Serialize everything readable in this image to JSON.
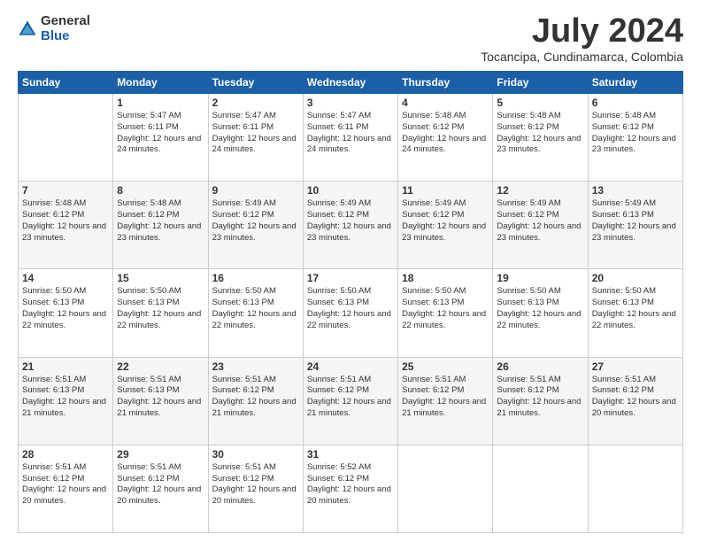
{
  "logo": {
    "general": "General",
    "blue": "Blue"
  },
  "title": "July 2024",
  "location": "Tocancipa, Cundinamarca, Colombia",
  "days_of_week": [
    "Sunday",
    "Monday",
    "Tuesday",
    "Wednesday",
    "Thursday",
    "Friday",
    "Saturday"
  ],
  "weeks": [
    [
      {
        "day": "",
        "sunrise": "",
        "sunset": "",
        "daylight": ""
      },
      {
        "day": "1",
        "sunrise": "Sunrise: 5:47 AM",
        "sunset": "Sunset: 6:11 PM",
        "daylight": "Daylight: 12 hours and 24 minutes."
      },
      {
        "day": "2",
        "sunrise": "Sunrise: 5:47 AM",
        "sunset": "Sunset: 6:11 PM",
        "daylight": "Daylight: 12 hours and 24 minutes."
      },
      {
        "day": "3",
        "sunrise": "Sunrise: 5:47 AM",
        "sunset": "Sunset: 6:11 PM",
        "daylight": "Daylight: 12 hours and 24 minutes."
      },
      {
        "day": "4",
        "sunrise": "Sunrise: 5:48 AM",
        "sunset": "Sunset: 6:12 PM",
        "daylight": "Daylight: 12 hours and 24 minutes."
      },
      {
        "day": "5",
        "sunrise": "Sunrise: 5:48 AM",
        "sunset": "Sunset: 6:12 PM",
        "daylight": "Daylight: 12 hours and 23 minutes."
      },
      {
        "day": "6",
        "sunrise": "Sunrise: 5:48 AM",
        "sunset": "Sunset: 6:12 PM",
        "daylight": "Daylight: 12 hours and 23 minutes."
      }
    ],
    [
      {
        "day": "7",
        "sunrise": "Sunrise: 5:48 AM",
        "sunset": "Sunset: 6:12 PM",
        "daylight": "Daylight: 12 hours and 23 minutes."
      },
      {
        "day": "8",
        "sunrise": "Sunrise: 5:48 AM",
        "sunset": "Sunset: 6:12 PM",
        "daylight": "Daylight: 12 hours and 23 minutes."
      },
      {
        "day": "9",
        "sunrise": "Sunrise: 5:49 AM",
        "sunset": "Sunset: 6:12 PM",
        "daylight": "Daylight: 12 hours and 23 minutes."
      },
      {
        "day": "10",
        "sunrise": "Sunrise: 5:49 AM",
        "sunset": "Sunset: 6:12 PM",
        "daylight": "Daylight: 12 hours and 23 minutes."
      },
      {
        "day": "11",
        "sunrise": "Sunrise: 5:49 AM",
        "sunset": "Sunset: 6:12 PM",
        "daylight": "Daylight: 12 hours and 23 minutes."
      },
      {
        "day": "12",
        "sunrise": "Sunrise: 5:49 AM",
        "sunset": "Sunset: 6:12 PM",
        "daylight": "Daylight: 12 hours and 23 minutes."
      },
      {
        "day": "13",
        "sunrise": "Sunrise: 5:49 AM",
        "sunset": "Sunset: 6:13 PM",
        "daylight": "Daylight: 12 hours and 23 minutes."
      }
    ],
    [
      {
        "day": "14",
        "sunrise": "Sunrise: 5:50 AM",
        "sunset": "Sunset: 6:13 PM",
        "daylight": "Daylight: 12 hours and 22 minutes."
      },
      {
        "day": "15",
        "sunrise": "Sunrise: 5:50 AM",
        "sunset": "Sunset: 6:13 PM",
        "daylight": "Daylight: 12 hours and 22 minutes."
      },
      {
        "day": "16",
        "sunrise": "Sunrise: 5:50 AM",
        "sunset": "Sunset: 6:13 PM",
        "daylight": "Daylight: 12 hours and 22 minutes."
      },
      {
        "day": "17",
        "sunrise": "Sunrise: 5:50 AM",
        "sunset": "Sunset: 6:13 PM",
        "daylight": "Daylight: 12 hours and 22 minutes."
      },
      {
        "day": "18",
        "sunrise": "Sunrise: 5:50 AM",
        "sunset": "Sunset: 6:13 PM",
        "daylight": "Daylight: 12 hours and 22 minutes."
      },
      {
        "day": "19",
        "sunrise": "Sunrise: 5:50 AM",
        "sunset": "Sunset: 6:13 PM",
        "daylight": "Daylight: 12 hours and 22 minutes."
      },
      {
        "day": "20",
        "sunrise": "Sunrise: 5:50 AM",
        "sunset": "Sunset: 6:13 PM",
        "daylight": "Daylight: 12 hours and 22 minutes."
      }
    ],
    [
      {
        "day": "21",
        "sunrise": "Sunrise: 5:51 AM",
        "sunset": "Sunset: 6:13 PM",
        "daylight": "Daylight: 12 hours and 21 minutes."
      },
      {
        "day": "22",
        "sunrise": "Sunrise: 5:51 AM",
        "sunset": "Sunset: 6:13 PM",
        "daylight": "Daylight: 12 hours and 21 minutes."
      },
      {
        "day": "23",
        "sunrise": "Sunrise: 5:51 AM",
        "sunset": "Sunset: 6:12 PM",
        "daylight": "Daylight: 12 hours and 21 minutes."
      },
      {
        "day": "24",
        "sunrise": "Sunrise: 5:51 AM",
        "sunset": "Sunset: 6:12 PM",
        "daylight": "Daylight: 12 hours and 21 minutes."
      },
      {
        "day": "25",
        "sunrise": "Sunrise: 5:51 AM",
        "sunset": "Sunset: 6:12 PM",
        "daylight": "Daylight: 12 hours and 21 minutes."
      },
      {
        "day": "26",
        "sunrise": "Sunrise: 5:51 AM",
        "sunset": "Sunset: 6:12 PM",
        "daylight": "Daylight: 12 hours and 21 minutes."
      },
      {
        "day": "27",
        "sunrise": "Sunrise: 5:51 AM",
        "sunset": "Sunset: 6:12 PM",
        "daylight": "Daylight: 12 hours and 20 minutes."
      }
    ],
    [
      {
        "day": "28",
        "sunrise": "Sunrise: 5:51 AM",
        "sunset": "Sunset: 6:12 PM",
        "daylight": "Daylight: 12 hours and 20 minutes."
      },
      {
        "day": "29",
        "sunrise": "Sunrise: 5:51 AM",
        "sunset": "Sunset: 6:12 PM",
        "daylight": "Daylight: 12 hours and 20 minutes."
      },
      {
        "day": "30",
        "sunrise": "Sunrise: 5:51 AM",
        "sunset": "Sunset: 6:12 PM",
        "daylight": "Daylight: 12 hours and 20 minutes."
      },
      {
        "day": "31",
        "sunrise": "Sunrise: 5:52 AM",
        "sunset": "Sunset: 6:12 PM",
        "daylight": "Daylight: 12 hours and 20 minutes."
      },
      {
        "day": "",
        "sunrise": "",
        "sunset": "",
        "daylight": ""
      },
      {
        "day": "",
        "sunrise": "",
        "sunset": "",
        "daylight": ""
      },
      {
        "day": "",
        "sunrise": "",
        "sunset": "",
        "daylight": ""
      }
    ]
  ]
}
